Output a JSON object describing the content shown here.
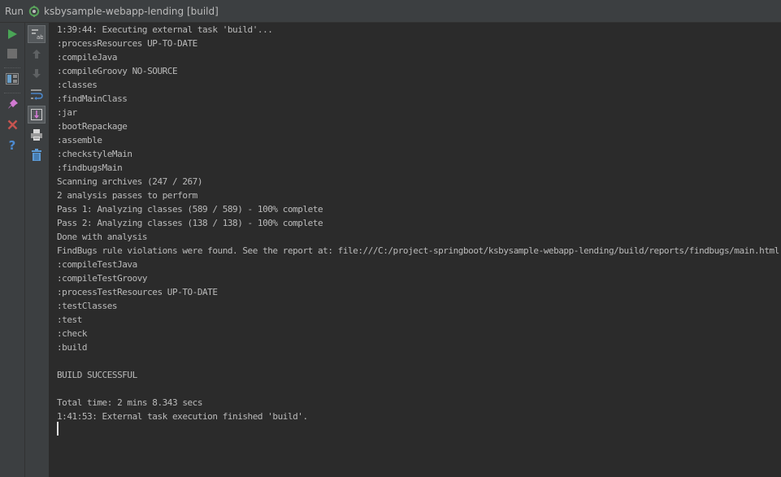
{
  "window": {
    "title_prefix": "Run",
    "title": "ksbysample-webapp-lending [build]"
  },
  "toolbar": {
    "primary": [
      {
        "name": "rerun-button",
        "icon": "play-icon",
        "color": "#4aa556"
      },
      {
        "name": "stop-button",
        "icon": "stop-icon",
        "color": "#6e6e6e"
      },
      {
        "name": "restore-layout-button",
        "icon": "layout-icon",
        "color": "#6a9fc9"
      },
      {
        "name": "pin-tab-button",
        "icon": "pin-icon",
        "color": "#d27ad3"
      },
      {
        "name": "close-button",
        "icon": "close-icon",
        "color": "#c75450"
      },
      {
        "name": "help-button",
        "icon": "help-icon",
        "color": "#4c8ad1"
      }
    ],
    "secondary": [
      {
        "name": "soft-wrap-toggle",
        "icon": "soft-wrap-icon"
      },
      {
        "name": "up-stack-button",
        "icon": "arrow-up-icon"
      },
      {
        "name": "down-stack-button",
        "icon": "arrow-down-icon"
      },
      {
        "name": "format-button",
        "icon": "format-icon"
      },
      {
        "name": "scroll-to-end-toggle",
        "icon": "scroll-end-icon"
      },
      {
        "name": "print-button",
        "icon": "print-icon"
      },
      {
        "name": "clear-all-button",
        "icon": "trash-icon"
      }
    ]
  },
  "console": {
    "lines": [
      "1:39:44: Executing external task 'build'...",
      ":processResources UP-TO-DATE",
      ":compileJava",
      ":compileGroovy NO-SOURCE",
      ":classes",
      ":findMainClass",
      ":jar",
      ":bootRepackage",
      ":assemble",
      ":checkstyleMain",
      ":findbugsMain",
      "Scanning archives (247 / 267)",
      "2 analysis passes to perform",
      "Pass 1: Analyzing classes (589 / 589) - 100% complete",
      "Pass 2: Analyzing classes (138 / 138) - 100% complete",
      "Done with analysis",
      "FindBugs rule violations were found. See the report at: file:///C:/project-springboot/ksbysample-webapp-lending/build/reports/findbugs/main.html",
      ":compileTestJava",
      ":compileTestGroovy",
      ":processTestResources UP-TO-DATE",
      ":testClasses",
      ":test",
      ":check",
      ":build",
      "",
      "BUILD SUCCESSFUL",
      "",
      "Total time: 2 mins 8.343 secs",
      "1:41:53: External task execution finished 'build'."
    ]
  },
  "colors": {
    "background": "#2b2b2b",
    "panel": "#3c3f41",
    "text": "#bbbbbb"
  }
}
